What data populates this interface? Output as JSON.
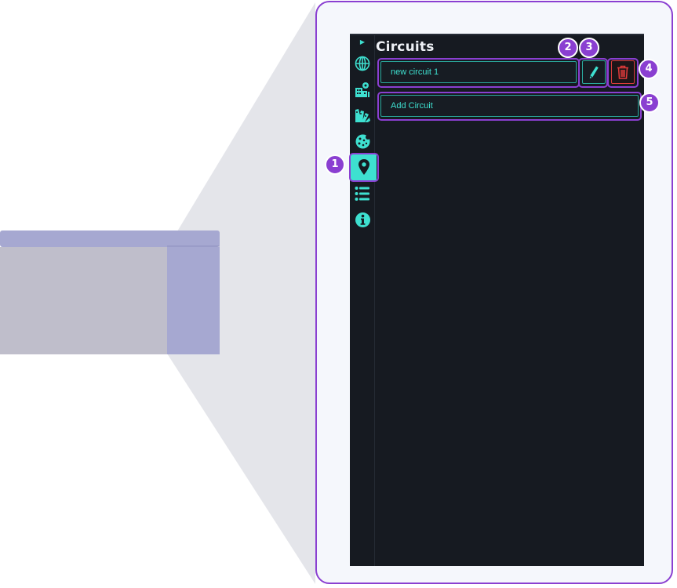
{
  "panel": {
    "title": "Circuits",
    "expand_icon": "caret-right-icon"
  },
  "rail": {
    "items": [
      {
        "icon": "globe-icon",
        "active": false
      },
      {
        "icon": "buildings-icon",
        "active": false
      },
      {
        "icon": "color-palette-icon",
        "active": false
      },
      {
        "icon": "cookie-icon",
        "active": false
      },
      {
        "icon": "map-pin-icon",
        "active": true
      },
      {
        "icon": "list-icon",
        "active": false
      },
      {
        "icon": "info-icon",
        "active": false
      }
    ]
  },
  "circuits": {
    "items": [
      {
        "name": "new circuit 1"
      }
    ],
    "edit_icon": "pencil-icon",
    "delete_icon": "trash-icon",
    "add_label": "Add Circuit"
  },
  "callouts": {
    "labels": [
      "1",
      "2",
      "3",
      "4",
      "5"
    ]
  },
  "colors": {
    "accent": "#3ee0d0",
    "panel_bg": "#161a21",
    "highlight": "#8a3fd1",
    "danger": "#d93b3b"
  }
}
